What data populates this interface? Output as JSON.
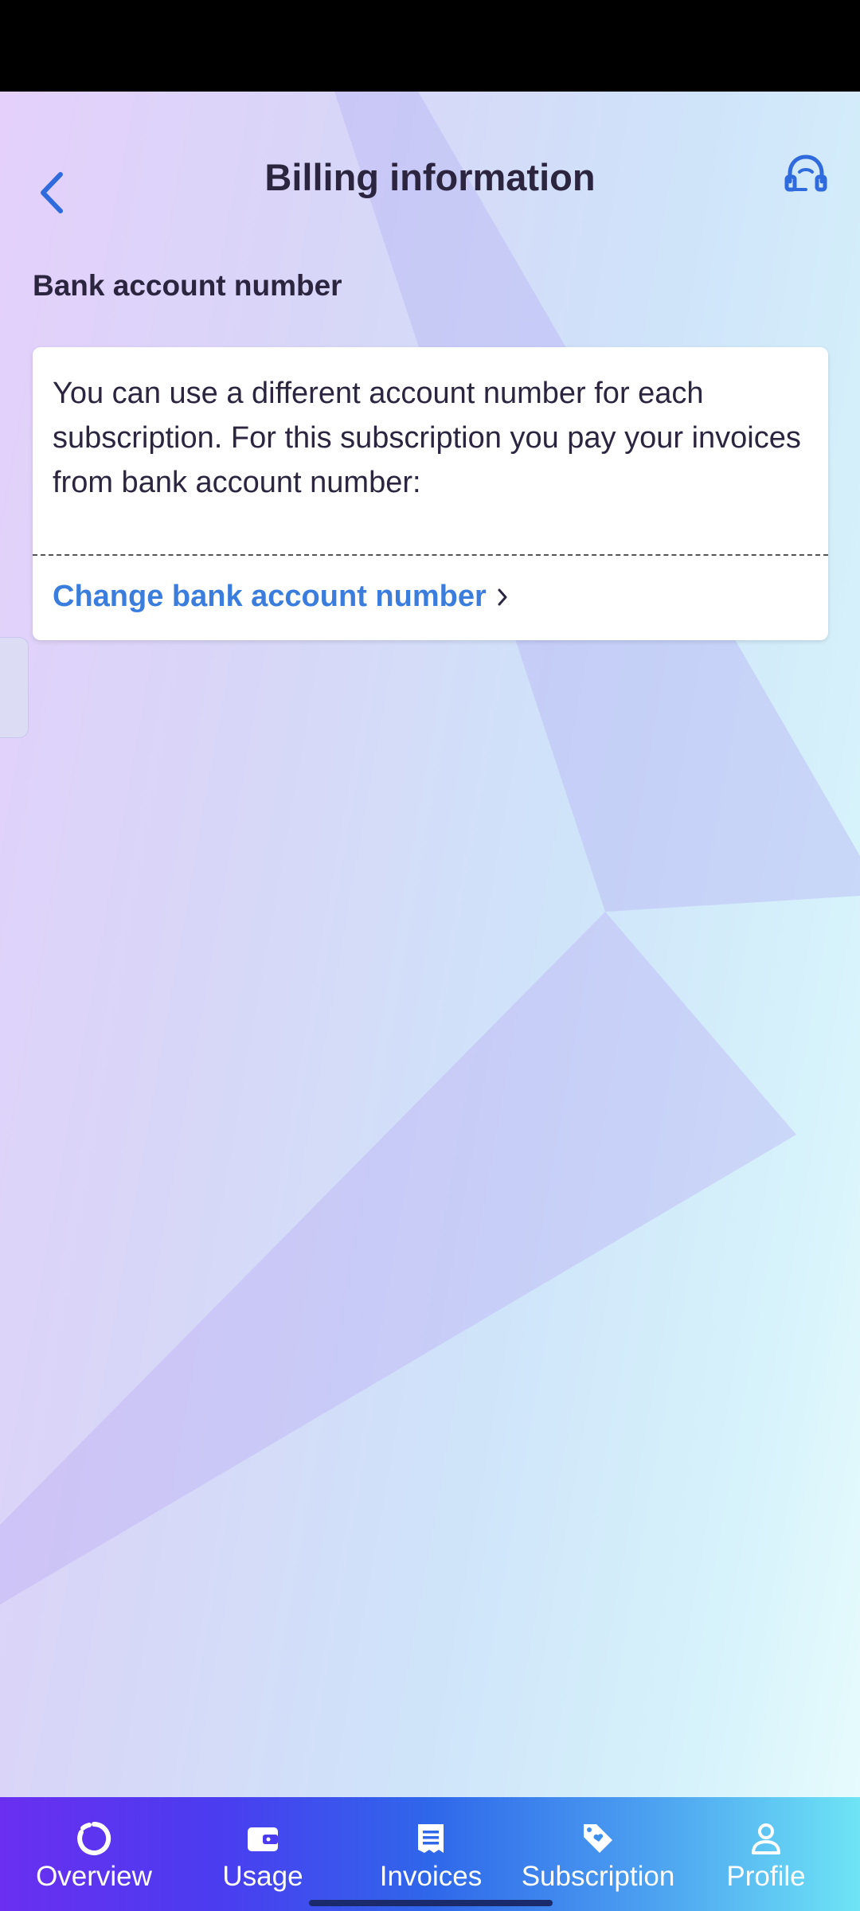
{
  "header": {
    "title": "Billing information"
  },
  "section": {
    "label": "Bank account number"
  },
  "card": {
    "text": "You can use a different account number for each subscription. For this subscription you pay your invoices from bank account number:",
    "link_label": "Change bank account number"
  },
  "bottom_nav": {
    "items": [
      {
        "label": "Overview",
        "icon": "overview-icon"
      },
      {
        "label": "Usage",
        "icon": "wallet-icon"
      },
      {
        "label": "Invoices",
        "icon": "invoice-icon"
      },
      {
        "label": "Subscription",
        "icon": "tag-heart-icon"
      },
      {
        "label": "Profile",
        "icon": "person-icon"
      }
    ]
  },
  "colors": {
    "accent": "#3b7ddd",
    "text": "#2c2540",
    "nav_start": "#6a2ff0",
    "nav_end": "#6ee4f5"
  }
}
